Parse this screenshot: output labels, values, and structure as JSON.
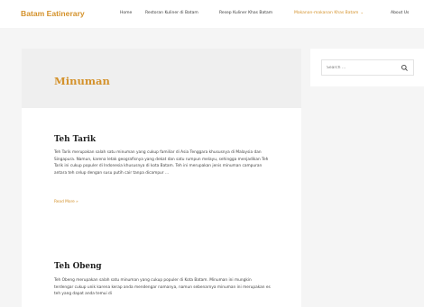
{
  "site": {
    "title": "Batam Eatinerary"
  },
  "nav": {
    "items": [
      {
        "label": "Home"
      },
      {
        "label": "Restoran Kuliner di Batam"
      },
      {
        "label": "Resep Kuliner Khas Batam"
      },
      {
        "label": "Makanan-makanan Khas Batam"
      },
      {
        "label": "About Us"
      }
    ],
    "active_color": "#d4922c"
  },
  "page": {
    "title": "Minuman"
  },
  "posts": [
    {
      "title": "Teh Tarik",
      "excerpt": "Teh Tarik merupakan salah satu minuman yang cukup familiar di Asia Tenggara khususnya di Malaysia dan Singapura. Namun, karena letak geografisnya yang dekat dan satu rumpun melayu, sehingga menjadikan Teh Tarik ini cukup populer di Indonesia khususnya di kota Batam. Teh ini merupakan jenis minuman campuran antara teh celup dengan susu putih cair tanpa dicampur …",
      "read_more": "Read More »"
    },
    {
      "title": "Teh Obeng",
      "excerpt": "Teh Obeng merupakan salah satu minuman yang cukup populer di Kota Batam. Minuman ini mungkin terdengar cukup unik karena kerap anda mendengar namanya, namun sebenarnya minuman ini merupakan es teh yang dapat anda temui di"
    }
  ],
  "sidebar": {
    "search_placeholder": "Search ..."
  },
  "icons": {
    "search": "search-icon",
    "chevron": "chevron-down-icon"
  },
  "colors": {
    "accent": "#d4922c",
    "background": "#f5f5f5",
    "hero": "#efefef"
  }
}
